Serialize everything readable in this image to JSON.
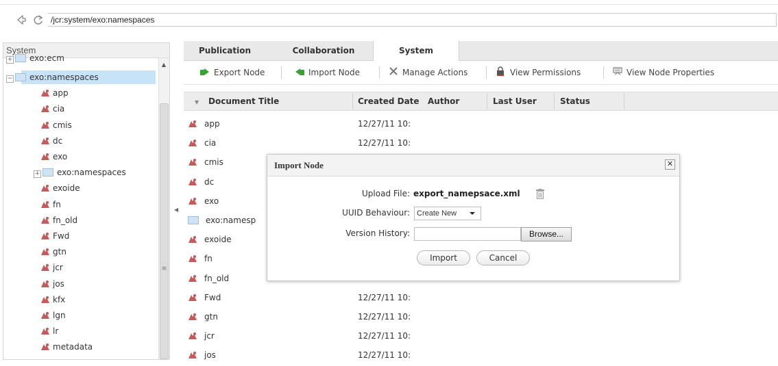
{
  "address_bar": {
    "path": "/jcr:system/exo:namespaces"
  },
  "left_panel": {
    "title": "System",
    "tree": [
      {
        "label": "exo:ecm",
        "kind": "folder"
      },
      {
        "label": "exo:namespaces",
        "kind": "folder",
        "selected": true
      },
      {
        "label": "app",
        "kind": "ns"
      },
      {
        "label": "cia",
        "kind": "ns"
      },
      {
        "label": "cmis",
        "kind": "ns"
      },
      {
        "label": "dc",
        "kind": "ns"
      },
      {
        "label": "exo",
        "kind": "ns"
      },
      {
        "label": "exo:namespaces",
        "kind": "folder"
      },
      {
        "label": "exoide",
        "kind": "ns"
      },
      {
        "label": "fn",
        "kind": "ns"
      },
      {
        "label": "fn_old",
        "kind": "ns"
      },
      {
        "label": "Fwd",
        "kind": "ns"
      },
      {
        "label": "gtn",
        "kind": "ns"
      },
      {
        "label": "jcr",
        "kind": "ns"
      },
      {
        "label": "jos",
        "kind": "ns"
      },
      {
        "label": "kfx",
        "kind": "ns"
      },
      {
        "label": "lgn",
        "kind": "ns"
      },
      {
        "label": "lr",
        "kind": "ns"
      },
      {
        "label": "metadata",
        "kind": "ns"
      }
    ]
  },
  "tabs": [
    {
      "label": "Publication"
    },
    {
      "label": "Collaboration"
    },
    {
      "label": "System",
      "active": true
    }
  ],
  "toolbar": {
    "export_node": "Export Node",
    "import_node": "Import Node",
    "manage_actions": "Manage Actions",
    "view_permissions": "View Permissions",
    "view_node_properties": "View Node Properties"
  },
  "list": {
    "columns": [
      "Document Title",
      "Created Date",
      "Author",
      "Last User",
      "Status"
    ],
    "rows": [
      {
        "title": "app",
        "date": "12/27/11 10:",
        "kind": "ns"
      },
      {
        "title": "cia",
        "date": "12/27/11 10:",
        "kind": "ns"
      },
      {
        "title": "cmis",
        "date": "",
        "kind": "ns"
      },
      {
        "title": "dc",
        "date": "",
        "kind": "ns"
      },
      {
        "title": "exo",
        "date": "",
        "kind": "ns"
      },
      {
        "title": "exo:namesp",
        "date": "",
        "kind": "folder"
      },
      {
        "title": "exoide",
        "date": "",
        "kind": "ns"
      },
      {
        "title": "fn",
        "date": "",
        "kind": "ns"
      },
      {
        "title": "fn_old",
        "date": "",
        "kind": "ns"
      },
      {
        "title": "Fwd",
        "date": "12/27/11 10:",
        "kind": "ns"
      },
      {
        "title": "gtn",
        "date": "12/27/11 10:",
        "kind": "ns"
      },
      {
        "title": "jcr",
        "date": "12/27/11 10:",
        "kind": "ns"
      },
      {
        "title": "jos",
        "date": "12/27/11 10:",
        "kind": "ns"
      }
    ]
  },
  "dialog": {
    "title": "Import Node",
    "upload_label": "Upload File:",
    "upload_file": "export_namepsace.xml",
    "uuid_label": "UUID Behaviour:",
    "uuid_value": "Create New",
    "version_label": "Version History:",
    "version_value": "",
    "browse": "Browse...",
    "import": "Import",
    "cancel": "Cancel"
  },
  "colors": {
    "selection": "#c7e3f7",
    "tab_strip": "#e9e9e9",
    "header_bg": "#ececec",
    "toolbar_icon_green": "#3aa13a"
  },
  "icons": [
    "back-arrow-icon",
    "reload-icon",
    "namespace-icon",
    "folder-icon",
    "expand-plus-icon",
    "export-icon",
    "import-icon",
    "manage-actions-icon",
    "lock-icon",
    "node-properties-icon",
    "sort-arrow-icon",
    "close-icon",
    "trash-icon",
    "dropdown-caret-icon",
    "collapse-arrow-icon"
  ]
}
